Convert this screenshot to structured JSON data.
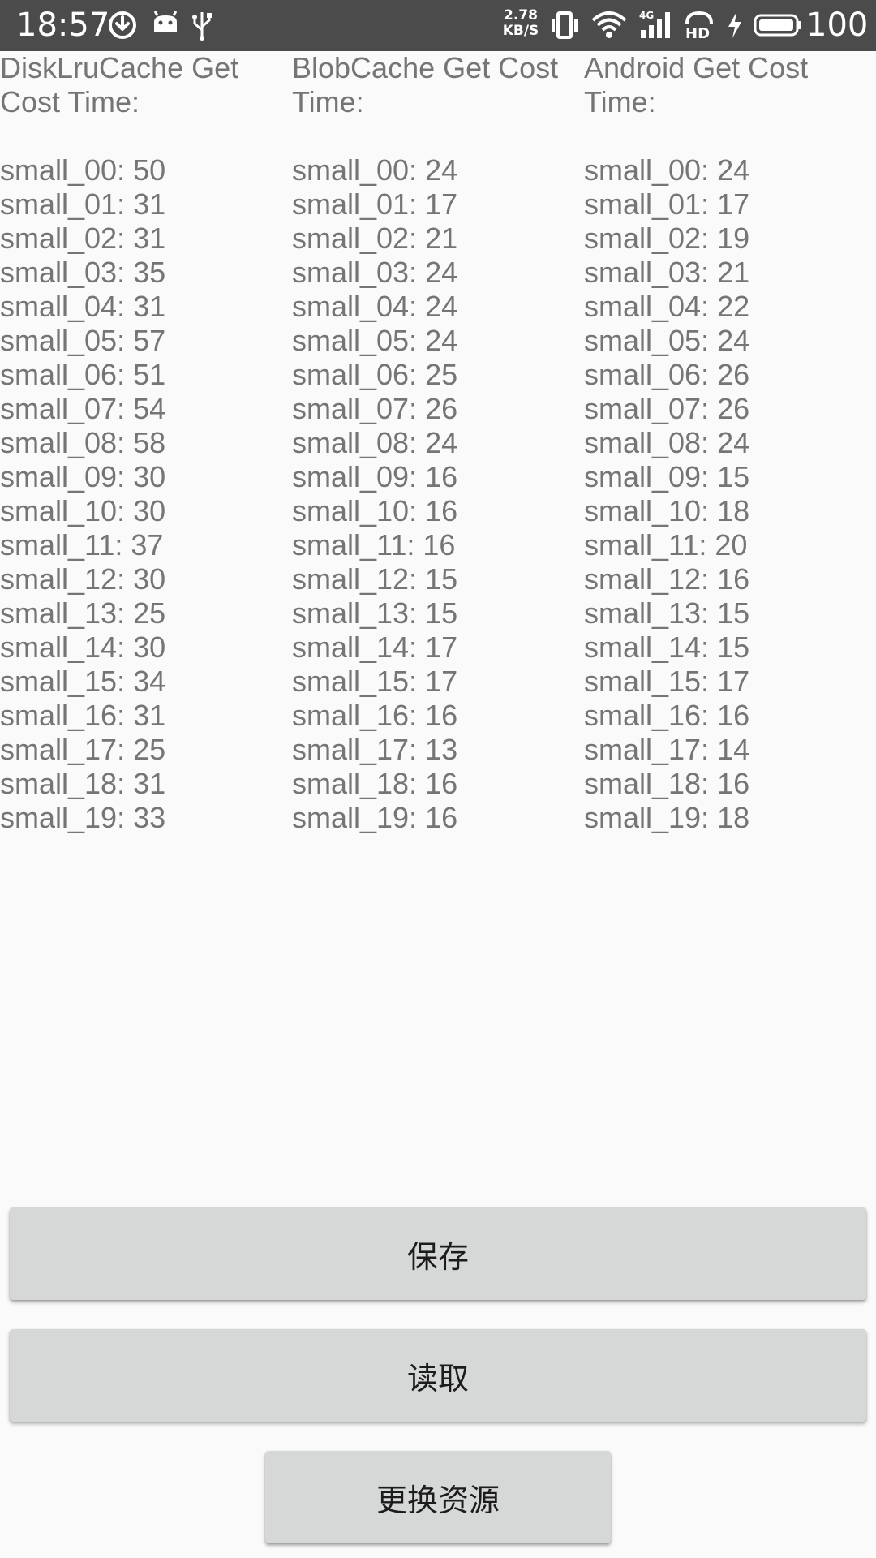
{
  "status_bar": {
    "time": "18:57",
    "net_speed_value": "2.78",
    "net_speed_unit": "KB/S",
    "battery_level": "100",
    "icons": [
      "download-icon",
      "android-icon",
      "usb-icon",
      "vibrate-icon",
      "wifi-icon",
      "signal-4g-icon",
      "hd-icon",
      "charging-icon",
      "battery-icon"
    ]
  },
  "columns": [
    {
      "header": "DiskLruCache Get Cost Time:",
      "rows": [
        "small_00: 50",
        "small_01: 31",
        "small_02: 31",
        "small_03: 35",
        "small_04: 31",
        "small_05: 57",
        "small_06: 51",
        "small_07: 54",
        "small_08: 58",
        "small_09: 30",
        "small_10: 30",
        "small_11: 37",
        "small_12: 30",
        "small_13: 25",
        "small_14: 30",
        "small_15: 34",
        "small_16: 31",
        "small_17: 25",
        "small_18: 31",
        "small_19: 33"
      ]
    },
    {
      "header": "BlobCache Get Cost Time:",
      "rows": [
        "small_00: 24",
        "small_01: 17",
        "small_02: 21",
        "small_03: 24",
        "small_04: 24",
        "small_05: 24",
        "small_06: 25",
        "small_07: 26",
        "small_08: 24",
        "small_09: 16",
        "small_10: 16",
        "small_11: 16",
        "small_12: 15",
        "small_13: 15",
        "small_14: 17",
        "small_15: 17",
        "small_16: 16",
        "small_17: 13",
        "small_18: 16",
        "small_19: 16"
      ]
    },
    {
      "header": "Android Get Cost Time:",
      "rows": [
        "small_00: 24",
        "small_01: 17",
        "small_02: 19",
        "small_03: 21",
        "small_04: 22",
        "small_05: 24",
        "small_06: 26",
        "small_07: 26",
        "small_08: 24",
        "small_09: 15",
        "small_10: 18",
        "small_11: 20",
        "small_12: 16",
        "small_13: 15",
        "small_14: 15",
        "small_15: 17",
        "small_16: 16",
        "small_17: 14",
        "small_18: 16",
        "small_19: 18"
      ]
    }
  ],
  "buttons": {
    "save": "保存",
    "read": "读取",
    "change_resource": "更换资源"
  },
  "colors": {
    "status_bar_bg": "#4b4b4b",
    "page_bg": "#fafafa",
    "text": "#757575",
    "button_bg": "#d6d7d7"
  }
}
